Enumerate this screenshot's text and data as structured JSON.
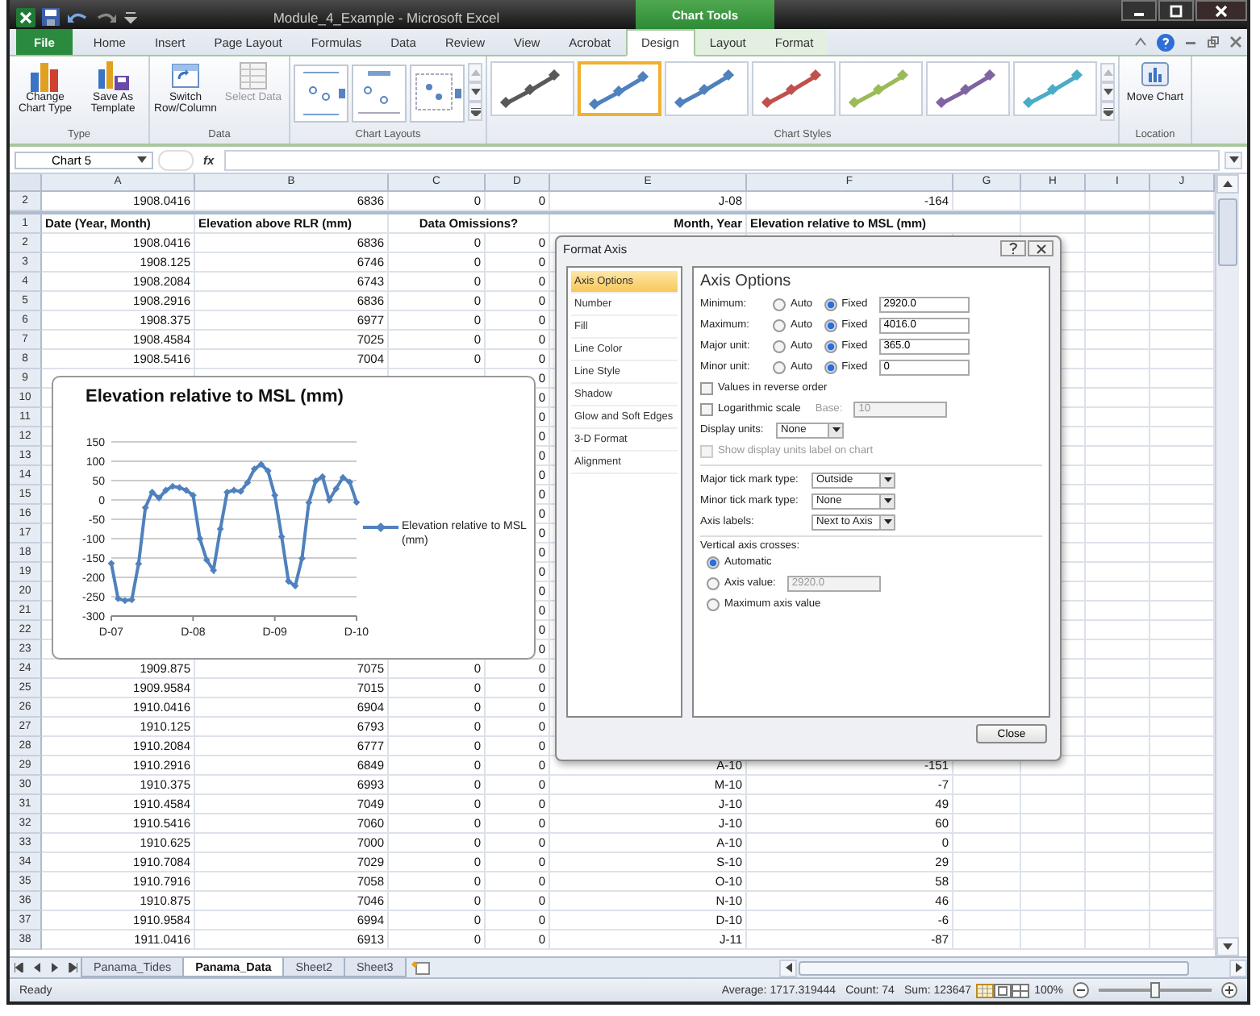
{
  "window": {
    "title": "Module_4_Example - Microsoft Excel",
    "context_group": "Chart Tools"
  },
  "ribbon_tabs": [
    {
      "label": "File",
      "kind": "file",
      "selected": false
    },
    {
      "label": "Home",
      "kind": "tab",
      "selected": false
    },
    {
      "label": "Insert",
      "kind": "tab",
      "selected": false
    },
    {
      "label": "Page Layout",
      "kind": "tab",
      "selected": false
    },
    {
      "label": "Formulas",
      "kind": "tab",
      "selected": false
    },
    {
      "label": "Data",
      "kind": "tab",
      "selected": false
    },
    {
      "label": "Review",
      "kind": "tab",
      "selected": false
    },
    {
      "label": "View",
      "kind": "tab",
      "selected": false
    },
    {
      "label": "Acrobat",
      "kind": "tab",
      "selected": false
    },
    {
      "label": "Design",
      "kind": "context",
      "selected": true
    },
    {
      "label": "Layout",
      "kind": "context",
      "selected": false
    },
    {
      "label": "Format",
      "kind": "context",
      "selected": false
    }
  ],
  "ribbon_groups": [
    {
      "label": "Type",
      "kind": "buttons",
      "buttons": [
        {
          "label": "Change Chart Type",
          "disabled": false
        },
        {
          "label": "Save As Template",
          "disabled": false
        }
      ]
    },
    {
      "label": "Data",
      "kind": "buttons",
      "buttons": [
        {
          "label": "Switch Row/Column",
          "disabled": false
        },
        {
          "label": "Select Data",
          "disabled": true
        }
      ]
    },
    {
      "label": "Chart Layouts",
      "kind": "layouts",
      "items": [
        {
          "selected": false
        },
        {
          "selected": false
        },
        {
          "selected": false
        }
      ]
    },
    {
      "label": "Chart Styles",
      "kind": "styles",
      "items": [
        {
          "color": "#595959",
          "selected": false
        },
        {
          "color": "#4f81bd",
          "selected": true
        },
        {
          "color": "#4f81bd",
          "selected": false
        },
        {
          "color": "#c0504d",
          "selected": false
        },
        {
          "color": "#9bbb59",
          "selected": false
        },
        {
          "color": "#8064a2",
          "selected": false
        },
        {
          "color": "#4bacc6",
          "selected": false
        }
      ]
    },
    {
      "label": "Location",
      "kind": "buttons",
      "buttons": [
        {
          "label": "Move Chart",
          "disabled": false
        }
      ]
    }
  ],
  "formula_bar": {
    "name_box": "Chart 5",
    "function_label": "fx"
  },
  "columns": [
    "A",
    "B",
    "C",
    "D",
    "E",
    "F",
    "G",
    "H",
    "I",
    "J"
  ],
  "frozen_row": {
    "number": "2",
    "a": "1908.0416",
    "b": "6836",
    "c": "0",
    "d": "0",
    "e": "J-08",
    "f": "-164"
  },
  "header_row": {
    "number": "1",
    "a": "Date (Year, Month)",
    "b": "Elevation above RLR (mm)",
    "c": "Data Omissions?",
    "e": "Month, Year",
    "f": "Elevation relative to MSL (mm)"
  },
  "rows": [
    {
      "number": "2",
      "a": "1908.0416",
      "b": "6836",
      "c": "0",
      "d": "0"
    },
    {
      "number": "3",
      "a": "1908.125",
      "b": "6746",
      "c": "0",
      "d": "0"
    },
    {
      "number": "4",
      "a": "1908.2084",
      "b": "6743",
      "c": "0",
      "d": "0"
    },
    {
      "number": "5",
      "a": "1908.2916",
      "b": "6836",
      "c": "0",
      "d": "0"
    },
    {
      "number": "6",
      "a": "1908.375",
      "b": "6977",
      "c": "0",
      "d": "0"
    },
    {
      "number": "7",
      "a": "1908.4584",
      "b": "7025",
      "c": "0",
      "d": "0"
    },
    {
      "number": "8",
      "a": "1908.5416",
      "b": "7004",
      "c": "0",
      "d": "0"
    },
    {
      "number": "9",
      "d": "0"
    },
    {
      "number": "10",
      "d": "0"
    },
    {
      "number": "11",
      "d": "0"
    },
    {
      "number": "12",
      "d": "0"
    },
    {
      "number": "13",
      "d": "0"
    },
    {
      "number": "14",
      "d": "0"
    },
    {
      "number": "15",
      "d": "0"
    },
    {
      "number": "16",
      "d": "0"
    },
    {
      "number": "17",
      "d": "0"
    },
    {
      "number": "18",
      "d": "0"
    },
    {
      "number": "19",
      "d": "0"
    },
    {
      "number": "20",
      "d": "0"
    },
    {
      "number": "21",
      "d": "0"
    },
    {
      "number": "22",
      "d": "0"
    },
    {
      "number": "23",
      "d": "0"
    },
    {
      "number": "24",
      "a": "1909.875",
      "b": "7075",
      "c": "0",
      "d": "0"
    },
    {
      "number": "25",
      "a": "1909.9584",
      "b": "7015",
      "c": "0",
      "d": "0"
    },
    {
      "number": "26",
      "a": "1910.0416",
      "b": "6904",
      "c": "0",
      "d": "0"
    },
    {
      "number": "27",
      "a": "1910.125",
      "b": "6793",
      "c": "0",
      "d": "0"
    },
    {
      "number": "28",
      "a": "1910.2084",
      "b": "6777",
      "c": "0",
      "d": "0"
    },
    {
      "number": "29",
      "a": "1910.2916",
      "b": "6849",
      "c": "0",
      "d": "0",
      "e": "A-10",
      "f": "-151"
    },
    {
      "number": "30",
      "a": "1910.375",
      "b": "6993",
      "c": "0",
      "d": "0",
      "e": "M-10",
      "f": "-7"
    },
    {
      "number": "31",
      "a": "1910.4584",
      "b": "7049",
      "c": "0",
      "d": "0",
      "e": "J-10",
      "f": "49"
    },
    {
      "number": "32",
      "a": "1910.5416",
      "b": "7060",
      "c": "0",
      "d": "0",
      "e": "J-10",
      "f": "60"
    },
    {
      "number": "33",
      "a": "1910.625",
      "b": "7000",
      "c": "0",
      "d": "0",
      "e": "A-10",
      "f": "0"
    },
    {
      "number": "34",
      "a": "1910.7084",
      "b": "7029",
      "c": "0",
      "d": "0",
      "e": "S-10",
      "f": "29"
    },
    {
      "number": "35",
      "a": "1910.7916",
      "b": "7058",
      "c": "0",
      "d": "0",
      "e": "O-10",
      "f": "58"
    },
    {
      "number": "36",
      "a": "1910.875",
      "b": "7046",
      "c": "0",
      "d": "0",
      "e": "N-10",
      "f": "46"
    },
    {
      "number": "37",
      "a": "1910.9584",
      "b": "6994",
      "c": "0",
      "d": "0",
      "e": "D-10",
      "f": "-6"
    },
    {
      "number": "38",
      "a": "1911.0416",
      "b": "6913",
      "c": "0",
      "d": "0",
      "e": "J-11",
      "f": "-87"
    }
  ],
  "chart": {
    "chart_data": {
      "type": "line",
      "title": "Elevation relative to MSL (mm)",
      "ylim": [
        -300,
        150
      ],
      "grid": true,
      "categories": [
        "D-07",
        null,
        null,
        null,
        null,
        null,
        null,
        null,
        null,
        null,
        null,
        null,
        "D-08",
        null,
        null,
        null,
        null,
        null,
        null,
        null,
        null,
        null,
        null,
        null,
        "D-09",
        null,
        null,
        null,
        null,
        null,
        null,
        null,
        null,
        null,
        null,
        null,
        "D-10"
      ],
      "yticks": [
        -300,
        -250,
        -200,
        -150,
        -100,
        -50,
        0,
        50,
        100,
        150
      ],
      "series": [
        {
          "name": "Elevation relative to MSL (mm)",
          "color": "#4f81bd",
          "marker": "diamond",
          "values": [
            -164,
            -255,
            -260,
            -258,
            -165,
            -20,
            20,
            5,
            25,
            35,
            32,
            25,
            12,
            -100,
            -155,
            -182,
            -75,
            20,
            25,
            22,
            45,
            80,
            92,
            75,
            12,
            -95,
            -210,
            -222,
            -151,
            -7,
            49,
            60,
            0,
            29,
            58,
            46,
            -6
          ]
        }
      ]
    }
  },
  "dialog": {
    "title": "Format Axis",
    "categories": [
      {
        "label": "Axis Options",
        "selected": true
      },
      {
        "label": "Number",
        "selected": false
      },
      {
        "label": "Fill",
        "selected": false
      },
      {
        "label": "Line Color",
        "selected": false
      },
      {
        "label": "Line Style",
        "selected": false
      },
      {
        "label": "Shadow",
        "selected": false
      },
      {
        "label": "Glow and Soft Edges",
        "selected": false
      },
      {
        "label": "3-D Format",
        "selected": false
      },
      {
        "label": "Alignment",
        "selected": false
      }
    ],
    "heading": "Axis Options",
    "bounds": [
      {
        "label": "Minimum:",
        "choices": [
          {
            "label": "Auto",
            "selected": false
          },
          {
            "label": "Fixed",
            "selected": true
          }
        ],
        "value": "2920.0"
      },
      {
        "label": "Maximum:",
        "choices": [
          {
            "label": "Auto",
            "selected": false
          },
          {
            "label": "Fixed",
            "selected": true
          }
        ],
        "value": "4016.0"
      },
      {
        "label": "Major unit:",
        "choices": [
          {
            "label": "Auto",
            "selected": false
          },
          {
            "label": "Fixed",
            "selected": true
          }
        ],
        "value": "365.0"
      },
      {
        "label": "Minor unit:",
        "choices": [
          {
            "label": "Auto",
            "selected": false
          },
          {
            "label": "Fixed",
            "selected": true
          }
        ],
        "value": "0"
      }
    ],
    "reverse_order": {
      "label": "Values in reverse order",
      "checked": false,
      "disabled": false
    },
    "log_scale": {
      "label": "Logarithmic scale",
      "checked": false,
      "disabled": false,
      "base_label": "Base:",
      "base_value": "10",
      "base_disabled": true
    },
    "display_units": {
      "label": "Display units:",
      "value": "None"
    },
    "show_units_label": {
      "label": "Show display units label on chart",
      "checked": false,
      "disabled": true
    },
    "dropdowns": [
      {
        "label": "Major tick mark type:",
        "value": "Outside"
      },
      {
        "label": "Minor tick mark type:",
        "value": "None"
      },
      {
        "label": "Axis labels:",
        "value": "Next to Axis"
      }
    ],
    "crosses_label": "Vertical axis crosses:",
    "crosses": [
      {
        "label": "Automatic",
        "selected": true
      },
      {
        "label": "Axis value:",
        "selected": false,
        "value": "2920.0",
        "disabled": true
      },
      {
        "label": "Maximum axis value",
        "selected": false
      }
    ],
    "close": "Close"
  },
  "sheet_tabs": [
    {
      "label": "Panama_Tides",
      "selected": false
    },
    {
      "label": "Panama_Data",
      "selected": true
    },
    {
      "label": "Sheet2",
      "selected": false
    },
    {
      "label": "Sheet3",
      "selected": false
    }
  ],
  "status_bar": {
    "mode": "Ready",
    "average": "Average: 1717.319444",
    "count": "Count: 74",
    "sum": "Sum: 123647",
    "zoom": "100%",
    "zoom_slider": {
      "level": 0.5
    }
  }
}
